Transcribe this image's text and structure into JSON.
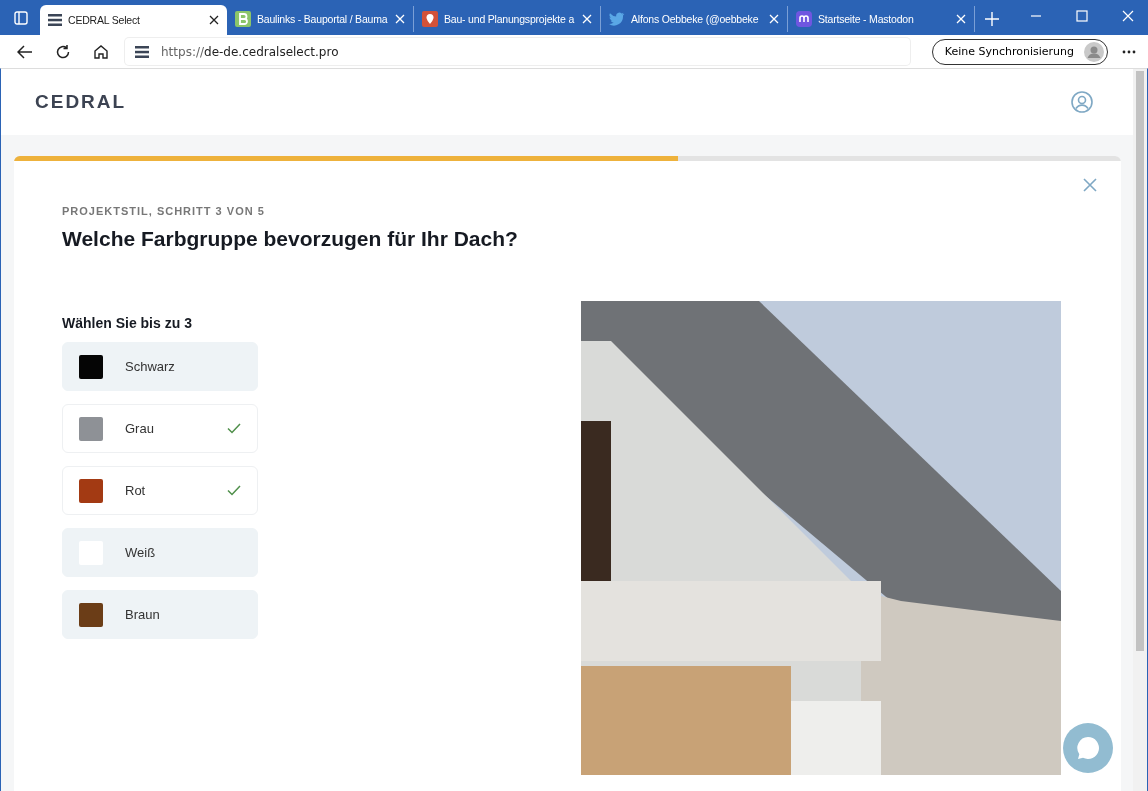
{
  "browser": {
    "tabs": [
      {
        "title": "CEDRAL Select",
        "selected": true
      },
      {
        "title": "Baulinks - Bauportal / Bauma",
        "selected": false
      },
      {
        "title": "Bau- und Planungsprojekte a",
        "selected": false
      },
      {
        "title": "Alfons Oebbeke (@oebbeke",
        "selected": false
      },
      {
        "title": "Startseite - Mastodon",
        "selected": false
      }
    ],
    "address": {
      "prefix": "https://",
      "host": "de-de.cedralselect.pro"
    },
    "sync_button": "Keine Synchronisierung"
  },
  "header": {
    "logo": "CEDRAL"
  },
  "progress": {
    "level": 0.6
  },
  "step": {
    "eyebrow": "PROJEKTSTIL, SCHRITT 3 VON 5",
    "question": "Welche Farbgruppe bevorzugen für Ihr Dach?",
    "hint": "Wählen Sie bis zu 3",
    "options": [
      {
        "label": "Schwarz",
        "color": "#050505",
        "selected": false
      },
      {
        "label": "Grau",
        "color": "#8e9196",
        "selected": true
      },
      {
        "label": "Rot",
        "color": "#a33a13",
        "selected": true
      },
      {
        "label": "Weiß",
        "color": "#ffffff",
        "selected": false
      },
      {
        "label": "Braun",
        "color": "#6b3d17",
        "selected": false
      }
    ]
  }
}
